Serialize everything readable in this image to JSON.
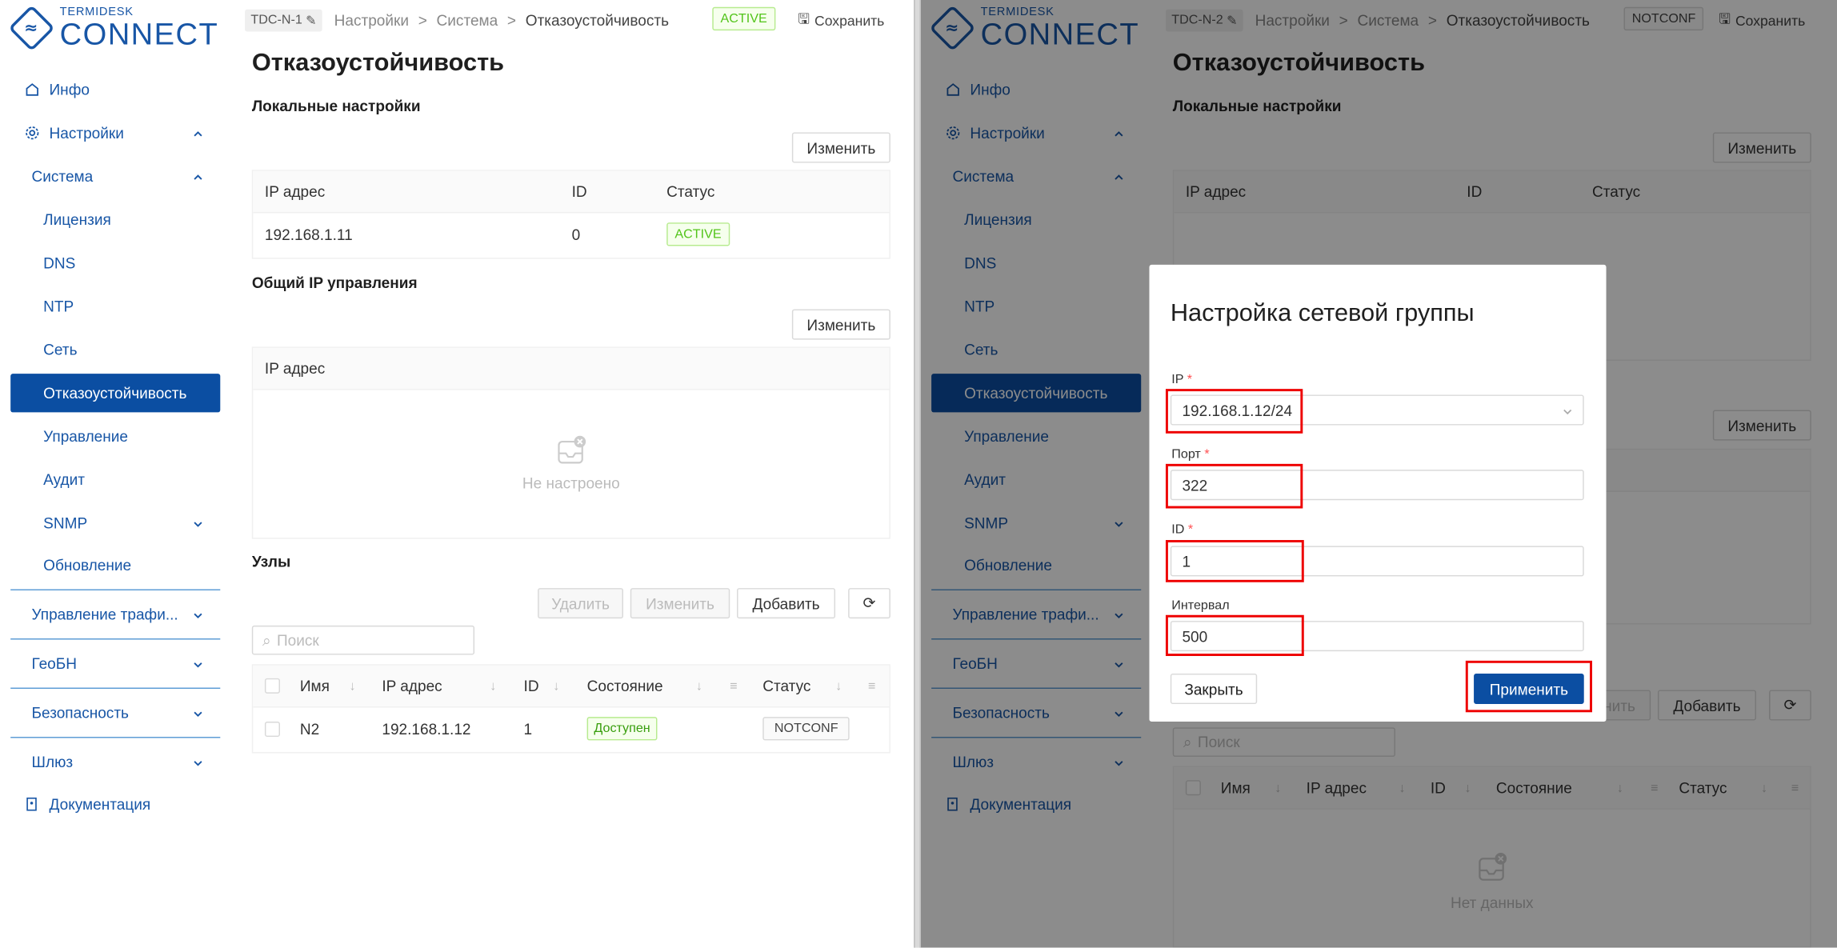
{
  "left": {
    "brand": {
      "small": "TERMIDESK",
      "big": "CONNECT"
    },
    "node_tag": "TDC-N-1",
    "breadcrumb": [
      "Настройки",
      "Система",
      "Отказоустойчивость"
    ],
    "breadcrumb_sep": ">",
    "status": "ACTIVE",
    "save": "Сохранить",
    "title": "Отказоустойчивость",
    "local": {
      "heading": "Локальные настройки",
      "edit": "Изменить",
      "cols": [
        "IP адрес",
        "ID",
        "Статус"
      ],
      "row": {
        "ip": "192.168.1.11",
        "id": "0",
        "status": "ACTIVE"
      }
    },
    "mgmt": {
      "heading": "Общий IP управления",
      "edit": "Изменить",
      "col": "IP адрес",
      "empty": "Не настроено"
    },
    "nodes": {
      "heading": "Узлы",
      "delete": "Удалить",
      "edit": "Изменить",
      "add": "Добавить",
      "search_placeholder": "Поиск",
      "cols": [
        "Имя",
        "IP адрес",
        "ID",
        "Состояние",
        "Статус"
      ],
      "row": {
        "name": "N2",
        "ip": "192.168.1.12",
        "id": "1",
        "state": "Доступен",
        "status": "NOTCONF"
      }
    }
  },
  "right": {
    "brand": {
      "small": "TERMIDESK",
      "big": "CONNECT"
    },
    "node_tag": "TDC-N-2",
    "breadcrumb": [
      "Настройки",
      "Система",
      "Отказоустойчивость"
    ],
    "breadcrumb_sep": ">",
    "status": "NOTCONF",
    "save": "Сохранить",
    "title": "Отказоустойчивость",
    "local": {
      "heading": "Локальные настройки",
      "edit": "Изменить",
      "cols": [
        "IP адрес",
        "ID",
        "Статус"
      ]
    },
    "mgmt": {
      "edit": "Изменить"
    },
    "nodes": {
      "edit": "Изменить",
      "add": "Добавить",
      "search_placeholder": "Поиск",
      "cols": [
        "Имя",
        "IP адрес",
        "ID",
        "Состояние",
        "Статус"
      ],
      "empty": "Нет данных"
    },
    "modal": {
      "title": "Настройка сетевой группы",
      "ip_label": "IP",
      "ip_value": "192.168.1.12/24",
      "port_label": "Порт",
      "port_value": "322",
      "id_label": "ID",
      "id_value": "1",
      "interval_label": "Интервал",
      "interval_value": "500",
      "close": "Закрыть",
      "apply": "Применить",
      "required_mark": "*"
    }
  },
  "sidebar": {
    "info": "Инфо",
    "settings": "Настройки",
    "system": "Система",
    "system_items": [
      "Лицензия",
      "DNS",
      "NTP",
      "Сеть",
      "Отказоустойчивость",
      "Управление",
      "Аудит",
      "SNMP",
      "Обновление"
    ],
    "groups": [
      "Управление трафи...",
      "ГеоБН",
      "Безопасность",
      "Шлюз"
    ],
    "docs": "Документация"
  },
  "colors": {
    "accent": "#0b4ea2",
    "brand": "#1856a6",
    "ok": "#52c41a",
    "highlight": "#e00000"
  }
}
